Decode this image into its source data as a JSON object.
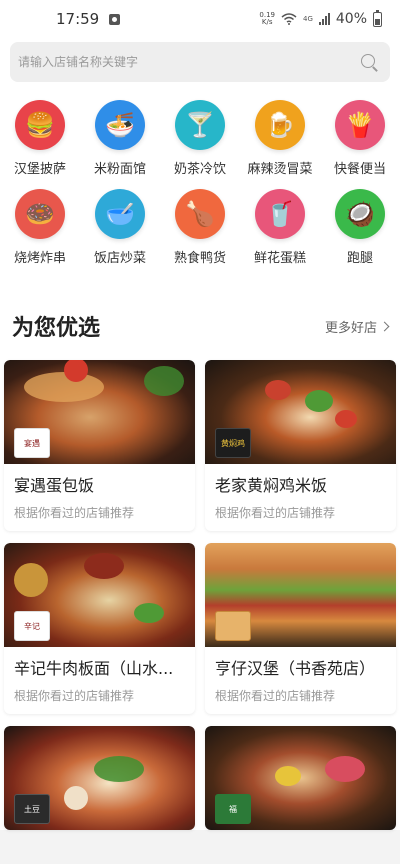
{
  "status_bar": {
    "time": "17:59",
    "net_speed_value": "0.19",
    "net_speed_unit": "K/s",
    "net_type": "4G",
    "battery": "40%"
  },
  "search": {
    "placeholder": "请输入店铺名称关键字",
    "icon": "search-icon"
  },
  "categories": [
    {
      "label": "汉堡披萨",
      "icon": "burger-icon",
      "color": "#e8434a"
    },
    {
      "label": "米粉面馆",
      "icon": "noodle-icon",
      "color": "#2f8ee8"
    },
    {
      "label": "奶茶冷饮",
      "icon": "cocktail-icon",
      "color": "#27b6c9"
    },
    {
      "label": "麻辣烫冒菜",
      "icon": "beer-icon",
      "color": "#f0a21d"
    },
    {
      "label": "快餐便当",
      "icon": "fastfood-icon",
      "color": "#e8567a"
    },
    {
      "label": "烧烤炸串",
      "icon": "donut-icon",
      "color": "#e8574c"
    },
    {
      "label": "饭店炒菜",
      "icon": "bowl-icon",
      "color": "#2ea9d8"
    },
    {
      "label": "熟食鸭货",
      "icon": "roast-chicken-icon",
      "color": "#f0683e"
    },
    {
      "label": "鲜花蛋糕",
      "icon": "drink-cup-icon",
      "color": "#e8567a"
    },
    {
      "label": "跑腿",
      "icon": "coconut-icon",
      "color": "#3ab94a"
    }
  ],
  "section": {
    "title": "为您优选",
    "more": "更多好店"
  },
  "shops": [
    {
      "name": "宴遇蛋包饭",
      "sub": "根据你看过的店铺推荐",
      "logo": "宴遇"
    },
    {
      "name": "老家黄焖鸡米饭",
      "sub": "根据你看过的店铺推荐",
      "logo": "黄焖鸡"
    },
    {
      "name": "辛记牛肉板面（山水...",
      "sub": "根据你看过的店铺推荐",
      "logo": "辛记"
    },
    {
      "name": "亨仔汉堡（书香苑店）",
      "sub": "根据你看过的店铺推荐",
      "logo": ""
    },
    {
      "name": "",
      "sub": "",
      "logo": "土豆"
    },
    {
      "name": "",
      "sub": "",
      "logo": "福"
    }
  ]
}
